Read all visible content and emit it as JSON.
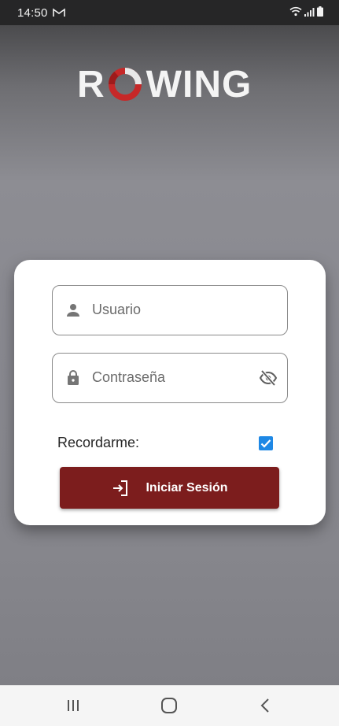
{
  "status_bar": {
    "time": "14:50",
    "icons": [
      "gmail-icon",
      "wifi-icon",
      "signal-icon",
      "battery-icon"
    ]
  },
  "logo": {
    "prefix": "R",
    "suffix": "WING",
    "colors": {
      "text": "#f4f4f4",
      "ring": "#c62828"
    }
  },
  "login": {
    "username_placeholder": "Usuario",
    "password_placeholder": "Contraseña",
    "remember_label": "Recordarme:",
    "remember_checked": true,
    "submit_label": "Iniciar Sesión",
    "icons": [
      "person-icon",
      "lock-icon",
      "visibility-off-icon",
      "login-icon"
    ]
  },
  "navigation_bar": {
    "icons": [
      "recent-apps-icon",
      "home-icon",
      "back-icon"
    ]
  },
  "colors": {
    "button": "#7c1d1d",
    "checkbox": "#1e88e5"
  }
}
